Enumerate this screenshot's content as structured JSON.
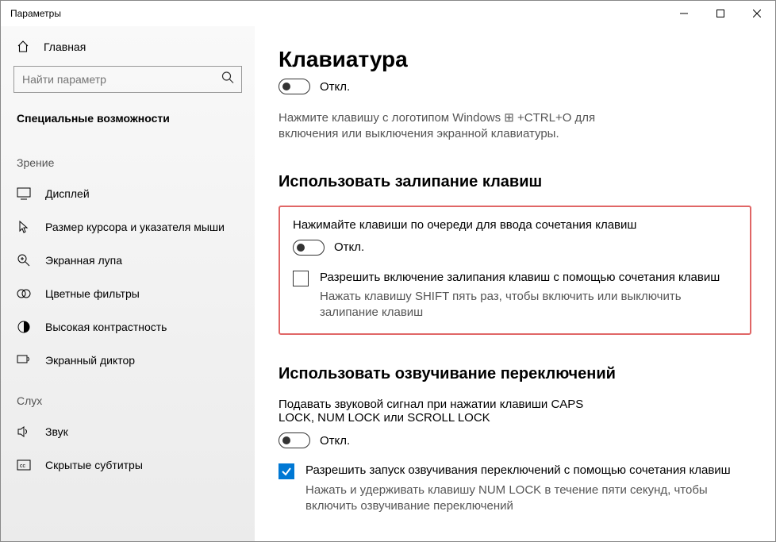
{
  "titlebar": {
    "title": "Параметры"
  },
  "sidebar": {
    "home_label": "Главная",
    "search_placeholder": "Найти параметр",
    "category_label": "Специальные возможности",
    "groups": {
      "0": {
        "title": "Зрение",
        "items": {
          "0": {
            "label": "Дисплей"
          },
          "1": {
            "label": "Размер курсора и указателя мыши"
          },
          "2": {
            "label": "Экранная лупа"
          },
          "3": {
            "label": "Цветные фильтры"
          },
          "4": {
            "label": "Высокая контрастность"
          },
          "5": {
            "label": "Экранный диктор"
          }
        }
      },
      "1": {
        "title": "Слух",
        "items": {
          "0": {
            "label": "Звук"
          },
          "1": {
            "label": "Скрытые субтитры"
          }
        }
      }
    }
  },
  "main": {
    "title": "Клавиатура",
    "top_toggle_label": "Откл.",
    "top_desc": "Нажмите клавишу с логотипом Windows ⊞ +CTRL+O для включения или выключения экранной клавиатуры.",
    "sticky": {
      "heading": "Использовать залипание клавиш",
      "label": "Нажимайте клавиши по очереди для ввода сочетания клавиш",
      "toggle_label": "Откл.",
      "check_primary": "Разрешить включение залипания клавиш с помощью сочетания клавиш",
      "check_secondary": "Нажать клавишу SHIFT пять раз, чтобы включить или выключить залипание клавиш"
    },
    "togglekeys": {
      "heading": "Использовать озвучивание переключений",
      "label": "Подавать звуковой сигнал при нажатии клавиши CAPS LOCK, NUM LOCK или SCROLL LOCK",
      "toggle_label": "Откл.",
      "check_primary": "Разрешить запуск озвучивания переключений с помощью сочетания клавиш",
      "check_secondary": "Нажать и удерживать клавишу NUM LOCK в течение пяти секунд, чтобы включить озвучивание переключений"
    }
  }
}
